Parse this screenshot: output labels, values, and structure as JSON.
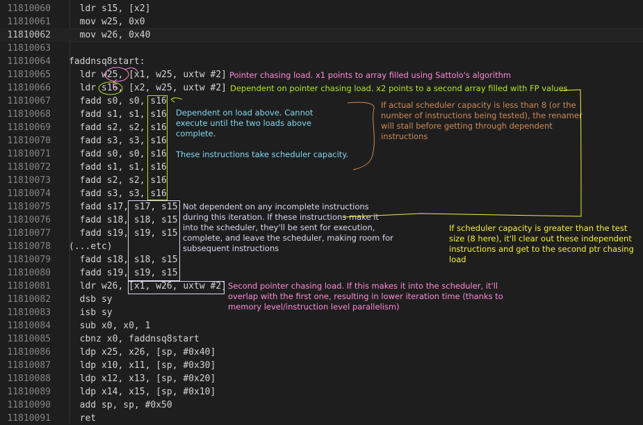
{
  "lines": [
    {
      "num": "11810060",
      "code": "  ldr s15, [x2]"
    },
    {
      "num": "11810061",
      "code": "  mov w25, 0x0"
    },
    {
      "num": "11810062",
      "code": "  mov w26, 0x40"
    },
    {
      "num": "11810063",
      "code": ""
    },
    {
      "num": "11810064",
      "code": "faddnsq8start:"
    },
    {
      "num": "11810065",
      "code": "  ldr w25, [x1, w25, uxtw #2]"
    },
    {
      "num": "11810066",
      "code": "  ldr s16, [x2, w25, uxtw #2]"
    },
    {
      "num": "11810067",
      "code": "  fadd s0, s0, s16"
    },
    {
      "num": "11810068",
      "code": "  fadd s1, s1, s16"
    },
    {
      "num": "11810069",
      "code": "  fadd s2, s2, s16"
    },
    {
      "num": "11810070",
      "code": "  fadd s3, s3, s16"
    },
    {
      "num": "11810071",
      "code": "  fadd s0, s0, s16"
    },
    {
      "num": "11810072",
      "code": "  fadd s1, s1, s16"
    },
    {
      "num": "11810073",
      "code": "  fadd s2, s2, s16"
    },
    {
      "num": "11810074",
      "code": "  fadd s3, s3, s16"
    },
    {
      "num": "11810075",
      "code": "  fadd s17, s17, s15"
    },
    {
      "num": "11810076",
      "code": "  fadd s18, s18, s15"
    },
    {
      "num": "11810077",
      "code": "  fadd s19, s19, s15"
    },
    {
      "num": "11810078",
      "code": "(...etc)"
    },
    {
      "num": "11810079",
      "code": "  fadd s18, s18, s15"
    },
    {
      "num": "11810080",
      "code": "  fadd s19, s19, s15"
    },
    {
      "num": "11810081",
      "code": "  ldr w26, [x1, w26, uxtw #2]"
    },
    {
      "num": "11810082",
      "code": "  dsb sy"
    },
    {
      "num": "11810083",
      "code": "  isb sy"
    },
    {
      "num": "11810084",
      "code": "  sub x0, x0, 1"
    },
    {
      "num": "11810085",
      "code": "  cbnz x0, faddnsq8start"
    },
    {
      "num": "11810086",
      "code": "  ldp x25, x26, [sp, #0x40]"
    },
    {
      "num": "11810087",
      "code": "  ldp x10, x11, [sp, #0x30]"
    },
    {
      "num": "11810088",
      "code": "  ldp x12, x13, [sp, #0x20]"
    },
    {
      "num": "11810089",
      "code": "  ldp x14, x15, [sp, #0x10]"
    },
    {
      "num": "11810090",
      "code": "  add sp, sp, #0x50"
    },
    {
      "num": "11810091",
      "code": "  ret"
    }
  ],
  "annotations": {
    "ptr_load": "Pointer chasing load. x1 points to array filled using Sattolo's algorithm",
    "dep_load": "Dependent on pointer chasing load. x2 points to a second array filled with FP values",
    "dep_fadd": "Dependent on load above. Cannot\nexecute until the two loads above\ncomplete.\n\nThese instructions take scheduler capacity.",
    "sched_less": "If actual scheduler capacity is less than 8 (or the\nnumber of instructions being tested), the renamer\nwill stall before getting through dependent\ninstructions",
    "indep": "Not dependent on any incomplete instructions\nduring this iteration. If these instructions make it\ninto the scheduler, they'll be sent for execution,\ncomplete, and leave the scheduler, making room for\nsubsequent instructions",
    "sched_greater": "If scheduler capacity is greater than the test\nsize (8 here), it'll clear out these independent\ninstructions and get to the second ptr chasing\nload",
    "second_load": "Second pointer chasing load. If this makes it into the scheduler, it'll\noverlap with the first one, resulting in lower iteration time (thanks to\nmemory level/instruction level parallelism)"
  },
  "colors": {
    "background": "#1e1e1e",
    "line_number": "#858585",
    "code": "#d4d4d4",
    "pink": "#ff8ad8",
    "green": "#b5e61d",
    "cyan": "#7fd8f0",
    "orange": "#d08a55",
    "yellow": "#f5f03c",
    "white": "#d8d8f0"
  }
}
